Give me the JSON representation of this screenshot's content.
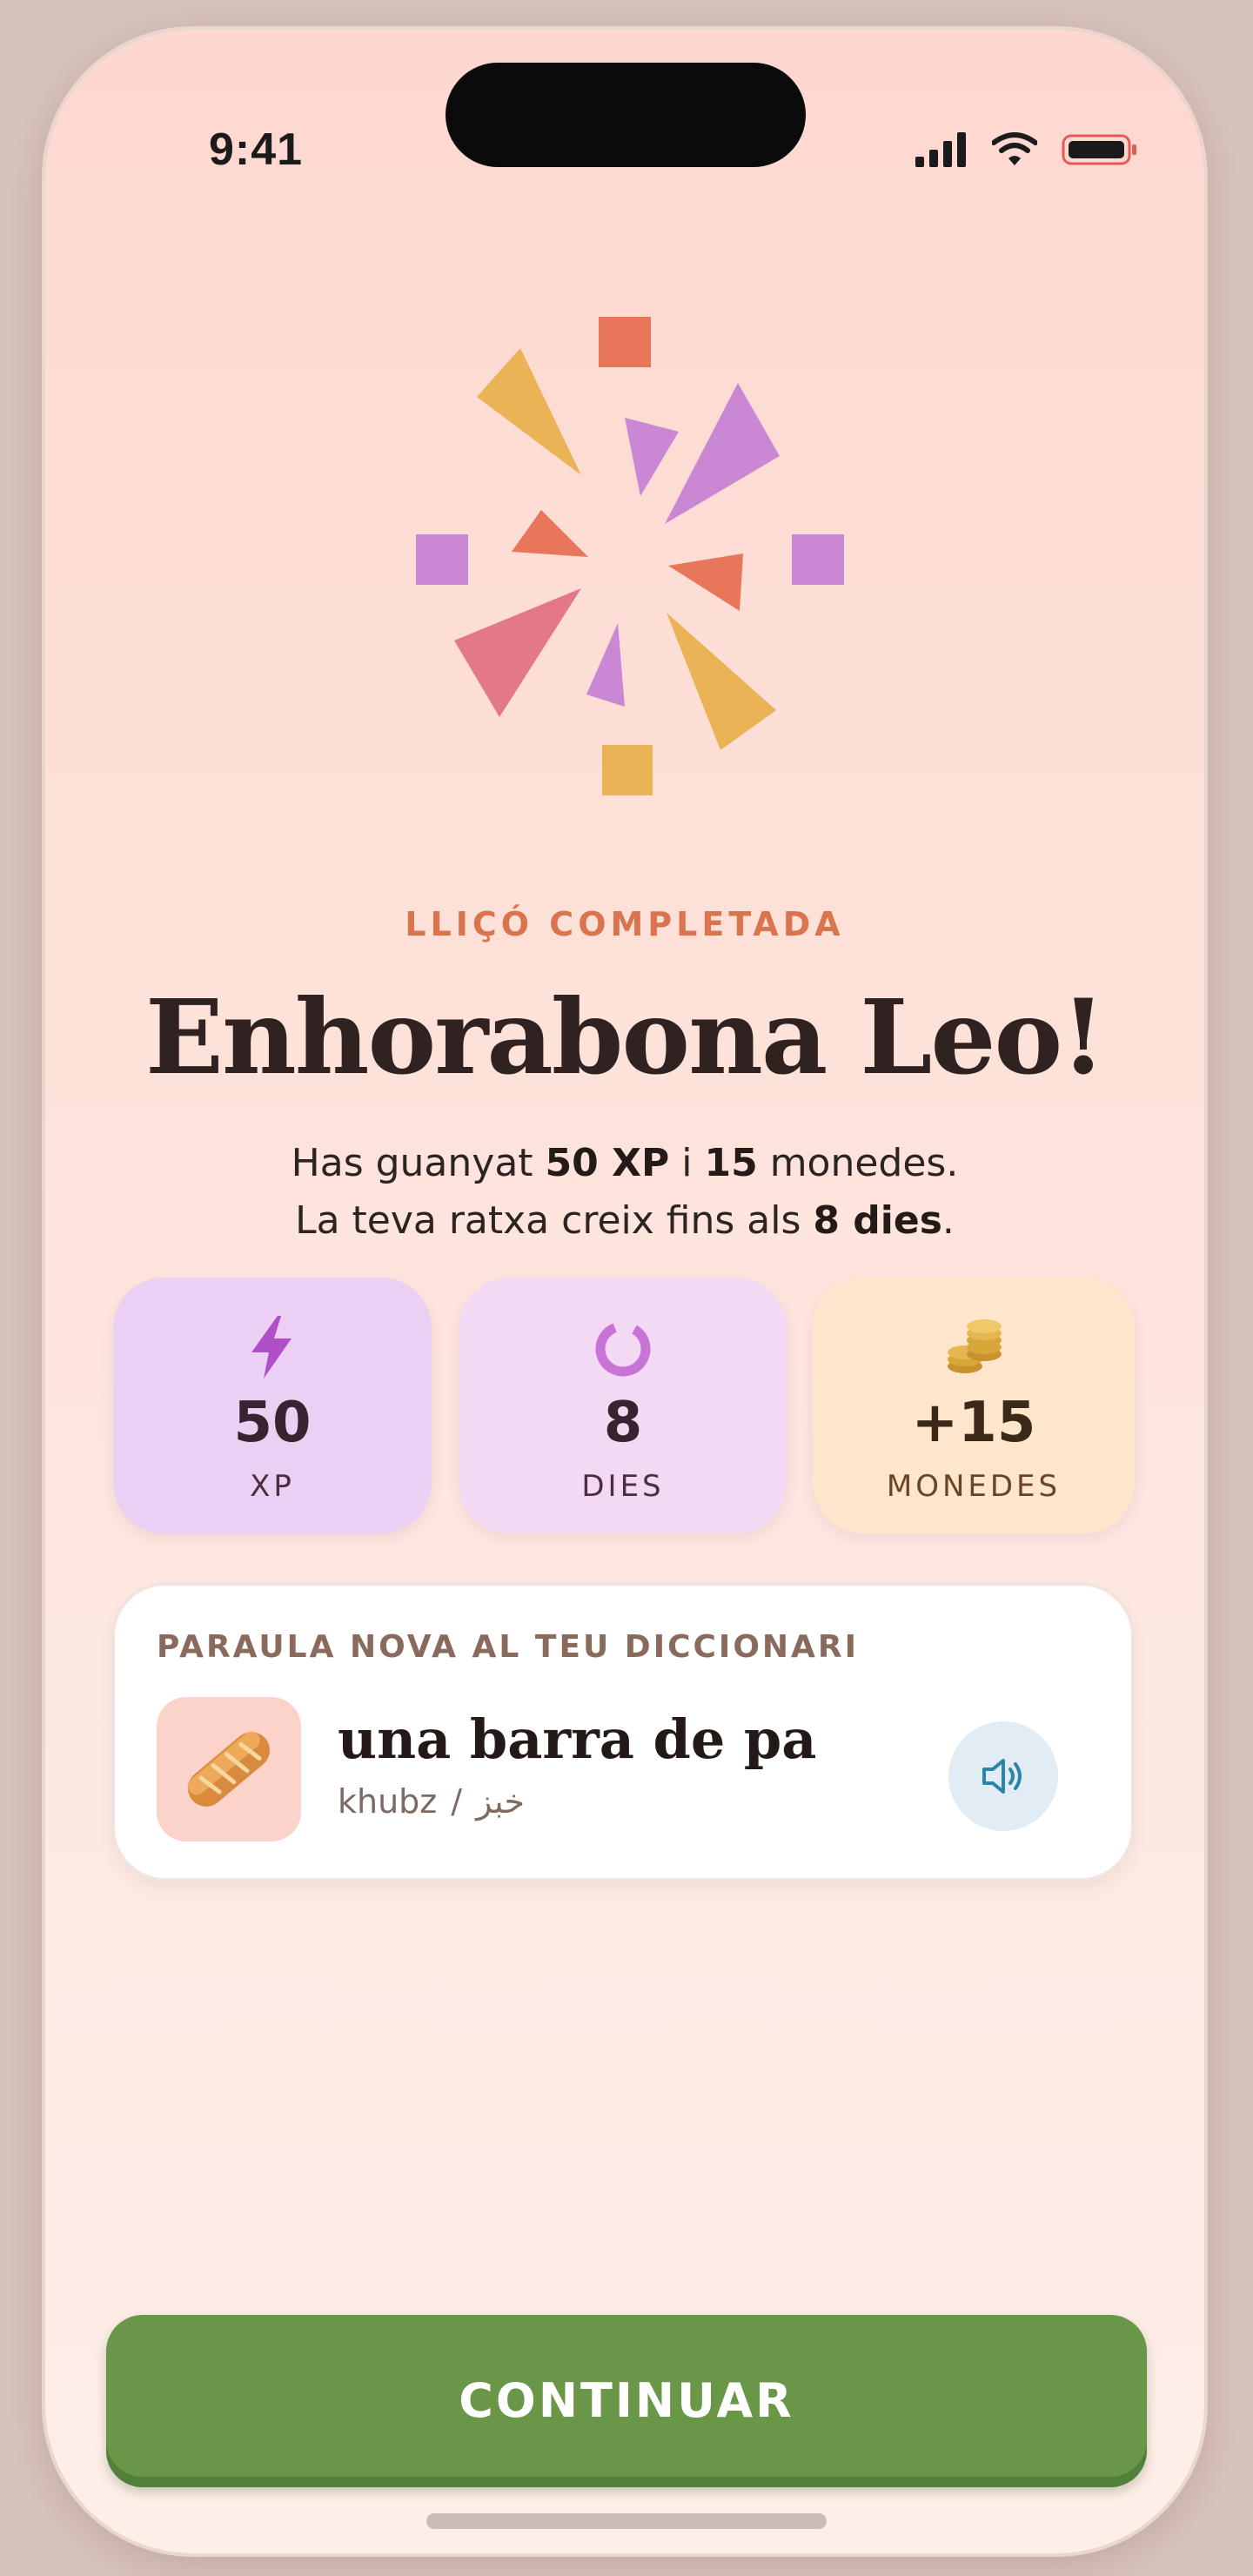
{
  "status_bar": {
    "time": "9:41"
  },
  "hero": {
    "illustration": "confetti-burst",
    "eyebrow": "LLIÇÓ COMPLETADA",
    "headline": "Enhorabona Leo!",
    "subtitle": {
      "line1_prefix": "Has guanyat ",
      "xp_amount": "50 XP",
      "line1_mid": " i ",
      "coins_amount": "15",
      "line1_suffix": " monedes.",
      "line2_prefix": "La teva ratxa creix fins als ",
      "streak_amount": "8 dies",
      "line2_suffix": "."
    }
  },
  "stats": [
    {
      "icon": "lightning-icon",
      "value": "50",
      "label": "XP",
      "color": "#b04fc8"
    },
    {
      "icon": "streak-ring-icon",
      "value": "8",
      "label": "DIES",
      "color": "#c873d6"
    },
    {
      "icon": "coins-icon",
      "value": "+15",
      "label": "MONEDES",
      "color": "#d9a63a"
    }
  ],
  "new_word": {
    "title": "PARAULA NOVA AL TEU DICCIONARI",
    "icon": "bread-icon",
    "word": "una barra de pa",
    "transliteration": "khubz",
    "separator": "/",
    "native": "خبز",
    "audio_icon": "speaker-icon"
  },
  "actions": {
    "continue_label": "CONTINUAR"
  },
  "colors": {
    "accent_orange": "#d9744e",
    "primary_green": "#6a9648",
    "headline": "#2f2220"
  }
}
